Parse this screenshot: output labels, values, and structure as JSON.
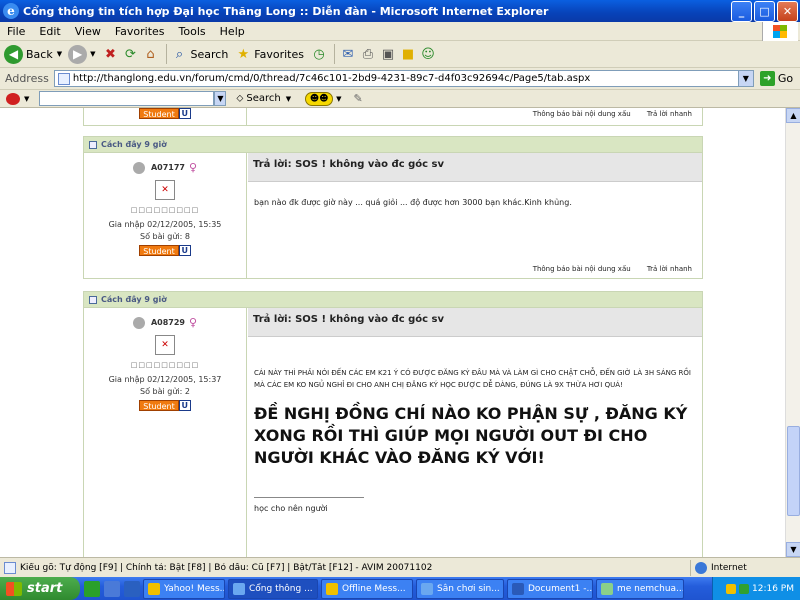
{
  "window": {
    "title": "Cổng thông tin tích hợp Đại học Thăng Long :: Diễn đàn - Microsoft Internet Explorer",
    "controls": [
      "_",
      "□",
      "✕"
    ]
  },
  "menu": [
    "File",
    "Edit",
    "View",
    "Favorites",
    "Tools",
    "Help"
  ],
  "toolbar": {
    "back": "Back",
    "search": "Search",
    "favorites": "Favorites"
  },
  "address": {
    "label": "Address",
    "url": "http://thanglong.edu.vn/forum/cmd/0/thread/7c46c101-2bd9-4231-89c7-d4f03c92694c/Page5/tab.aspx",
    "go": "Go"
  },
  "linkbar": {
    "search_label": "Search"
  },
  "posts": [
    {
      "time": "",
      "badge": "Student",
      "badge_u": "U",
      "footer": [
        "Thông báo bài nội dung xấu",
        "Trả lời nhanh"
      ]
    },
    {
      "time": "Cách đây 9 giờ",
      "username": "A07177",
      "join": "Gia nhập 02/12/2005, 15:35",
      "count": "Số bài gửi: 8",
      "badge": "Student",
      "badge_u": "U",
      "subject": "Trả lời: SOS ! không vào đc góc sv",
      "body": "bạn nào đk được giờ này ... quá giỏi ... độ được hơn 3000 bạn khác.Kinh khủng.",
      "footer": [
        "Thông báo bài nội dung xấu",
        "Trả lời nhanh"
      ]
    },
    {
      "time": "Cách đây 9 giờ",
      "username": "A08729",
      "join": "Gia nhập 02/12/2005, 15:37",
      "count": "Số bài gửi: 2",
      "badge": "Student",
      "badge_u": "U",
      "subject": "Trả lời: SOS ! không vào đc góc sv",
      "body": "CÁI NÀY THÌ PHẢI NÓI ĐẾN CÁC EM K21 Ý CÓ ĐƯỢC ĐĂNG KÝ ĐÂU MÀ VÀ LÀM GÌ CHO CHẬT CHỖ, ĐẾN GIỜ LÀ 3H SÁNG RỒI MÀ CÁC EM KO NGỦ NGHỈ ĐI CHO ANH CHỊ ĐĂNG KÝ HỌC ĐƯỢC DỄ DÀNG, ĐÚNG LÀ 9X THỪA HƠI QUÁ!",
      "big": "ĐỀ NGHỊ ĐỒNG CHÍ NÀO KO PHẬN SỰ , ĐĂNG KÝ XONG RỒI THÌ GIÚP MỌI NGƯỜI OUT ĐI CHO NGƯỜI KHÁC VÀO ĐĂNG KÝ VỚI!",
      "signature": "học cho nên người"
    }
  ],
  "statusbar": {
    "text": "Kiểu gõ: Tự động [F9] | Chính tả: Bật [F8] | Bỏ dấu: Cũ [F7] | Bật/Tắt [F12] - AVIM 20071102",
    "zone": "Internet"
  },
  "taskbar": {
    "start": "start",
    "tasks": [
      "Yahoo! Mess...",
      "Cổng thông ...",
      "Offline Mess...",
      "Sân chơi sin...",
      "Document1 -...",
      "me nemchua..."
    ],
    "clock": "12:16 PM"
  },
  "colors": {
    "accent": "#0a5fe0",
    "post_header": "#d9e6c2",
    "badge": "#f07a10"
  }
}
